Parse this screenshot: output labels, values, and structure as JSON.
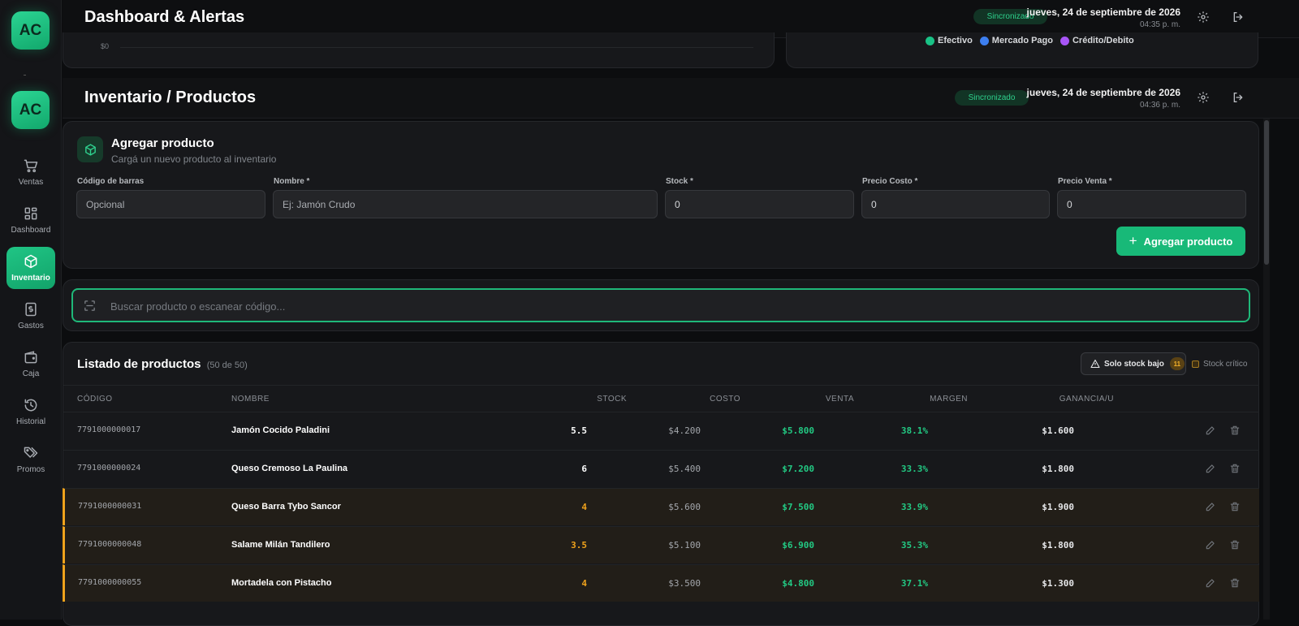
{
  "sidebar": {
    "logo_text": "AC",
    "items": [
      {
        "label": "Ventas",
        "icon": "cart-icon"
      },
      {
        "label": "Dashboard",
        "icon": "grid-icon"
      },
      {
        "label": "Inventario",
        "icon": "box-icon",
        "active": true
      },
      {
        "label": "Gastos",
        "icon": "dollar-file-icon"
      },
      {
        "label": "Caja",
        "icon": "wallet-icon"
      },
      {
        "label": "Historial",
        "icon": "history-icon"
      },
      {
        "label": "Promos",
        "icon": "tags-icon"
      }
    ]
  },
  "dashboard_header": {
    "title": "Dashboard & Alertas",
    "sync_status": "Sincronizado",
    "date": "jueves, 24 de septiembre de 2026",
    "time": "04:35 p. m.",
    "chart_axis_label": "$0",
    "legend": [
      {
        "label": "Efectivo",
        "color": "#19c286"
      },
      {
        "label": "Mercado Pago",
        "color": "#3d7ff0"
      },
      {
        "label": "Crédito/Debito",
        "color": "#a855f7"
      }
    ]
  },
  "header": {
    "title": "Inventario / Productos",
    "sync_status": "Sincronizado",
    "date": "jueves, 24 de septiembre de 2026",
    "time": "04:36 p. m."
  },
  "add_product": {
    "title": "Agregar producto",
    "subtitle": "Cargá un nuevo producto al inventario",
    "fields": {
      "barcode": {
        "label": "Código de barras",
        "placeholder": "Opcional"
      },
      "name": {
        "label": "Nombre *",
        "placeholder": "Ej: Jamón Crudo"
      },
      "stock": {
        "label": "Stock *",
        "value": "0"
      },
      "cost": {
        "label": "Precio Costo *",
        "value": "0"
      },
      "price": {
        "label": "Precio Venta *",
        "value": "0"
      }
    },
    "button_label": "Agregar producto"
  },
  "search": {
    "placeholder": "Buscar producto o escanear código..."
  },
  "list": {
    "title": "Listado de productos",
    "count": "(50 de 50)",
    "low_stock_filter": "Solo stock bajo",
    "low_stock_count": "11",
    "critical_label": "Stock crítico",
    "columns": [
      "CÓDIGO",
      "NOMBRE",
      "STOCK",
      "COSTO",
      "VENTA",
      "MARGEN",
      "GANANCIA/U"
    ],
    "rows": [
      {
        "code": "7791000000017",
        "name": "Jamón Cocido Paladini",
        "stock": "5.5",
        "cost": "$4.200",
        "price": "$5.800",
        "margin": "38.1%",
        "profit": "$1.600",
        "low": false
      },
      {
        "code": "7791000000024",
        "name": "Queso Cremoso La Paulina",
        "stock": "6",
        "cost": "$5.400",
        "price": "$7.200",
        "margin": "33.3%",
        "profit": "$1.800",
        "low": false
      },
      {
        "code": "7791000000031",
        "name": "Queso Barra Tybo Sancor",
        "stock": "4",
        "cost": "$5.600",
        "price": "$7.500",
        "margin": "33.9%",
        "profit": "$1.900",
        "low": true
      },
      {
        "code": "7791000000048",
        "name": "Salame Milán Tandilero",
        "stock": "3.5",
        "cost": "$5.100",
        "price": "$6.900",
        "margin": "35.3%",
        "profit": "$1.800",
        "low": true
      },
      {
        "code": "7791000000055",
        "name": "Mortadela con Pistacho",
        "stock": "4",
        "cost": "$3.500",
        "price": "$4.800",
        "margin": "37.1%",
        "profit": "$1.300",
        "low": true
      }
    ]
  },
  "colors": {
    "accent": "#18b978",
    "low_stock": "#f0a31c",
    "background": "#0c0d0f"
  }
}
